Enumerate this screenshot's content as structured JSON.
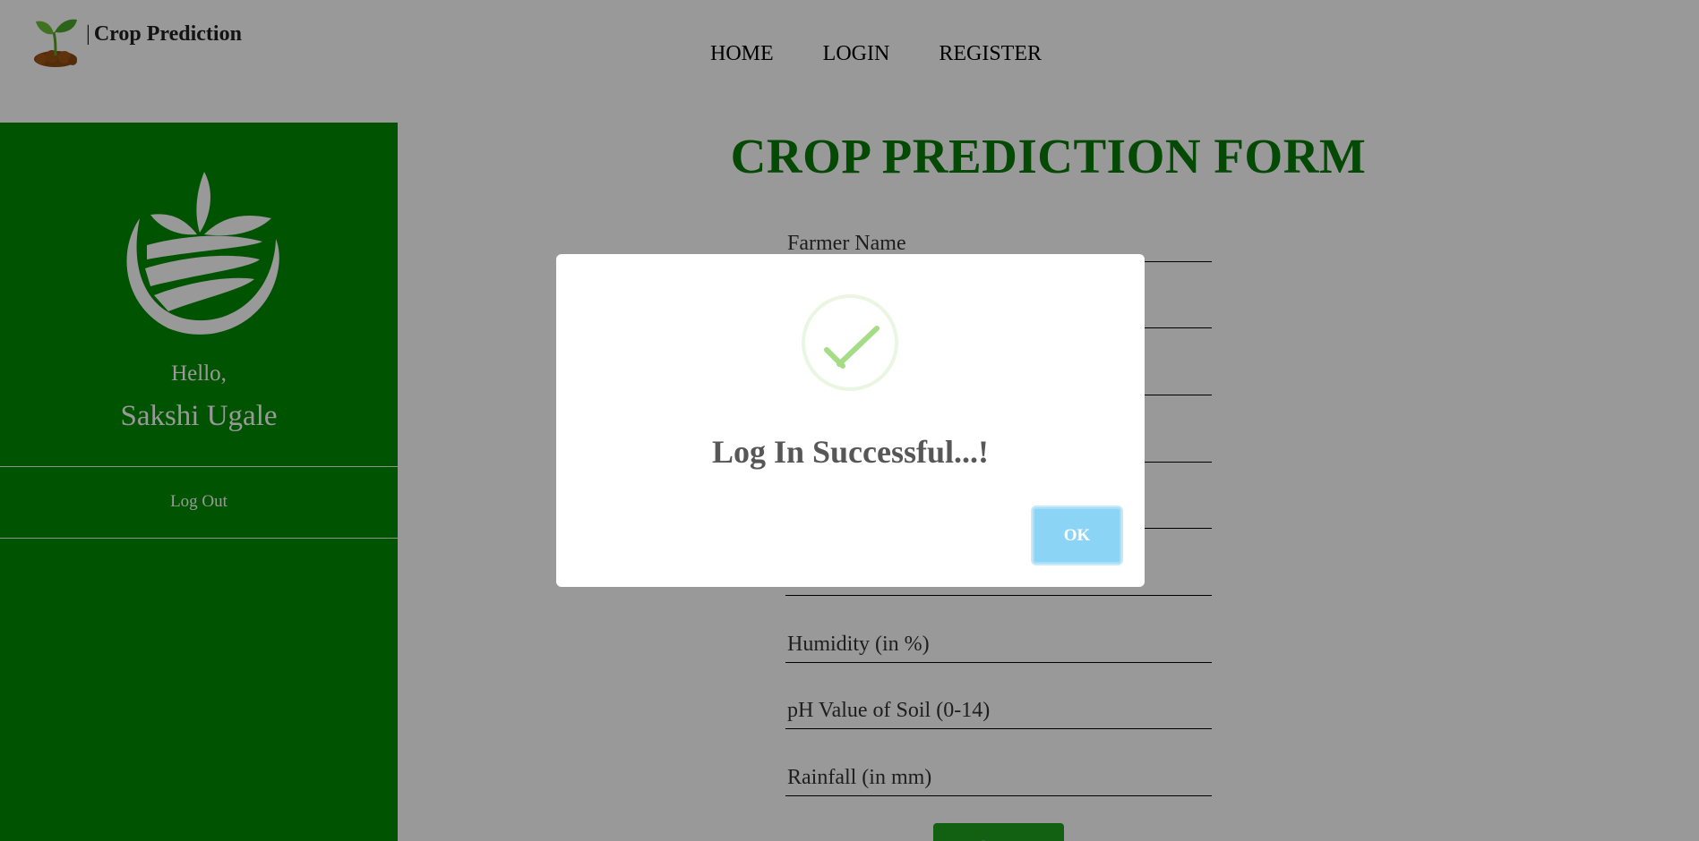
{
  "header": {
    "brand_separator": "|",
    "brand_title": "Crop Prediction",
    "nav": [
      {
        "label": "HOME"
      },
      {
        "label": "LOGIN"
      },
      {
        "label": "REGISTER"
      }
    ]
  },
  "sidebar": {
    "greeting": "Hello,",
    "user_name": "Sakshi Ugale",
    "logout_label": "Log Out"
  },
  "form": {
    "title": "CROP PREDICTION FORM",
    "fields": [
      {
        "placeholder": "Farmer Name"
      },
      {
        "placeholder": ""
      },
      {
        "placeholder": ""
      },
      {
        "placeholder": ""
      },
      {
        "placeholder": ""
      },
      {
        "placeholder": ""
      },
      {
        "placeholder": "Humidity (in %)"
      },
      {
        "placeholder": "pH Value of Soil (0-14)"
      },
      {
        "placeholder": "Rainfall (in mm)"
      }
    ],
    "submit_label": "Predict Crop"
  },
  "modal": {
    "icon": "success-check-icon",
    "title": "Log In Successful...!",
    "ok_label": "OK"
  },
  "colors": {
    "sidebar_bg": "#008a00",
    "title_green": "#087a08",
    "ok_button": "#8cd4f5",
    "check_green": "#a5dc86"
  }
}
